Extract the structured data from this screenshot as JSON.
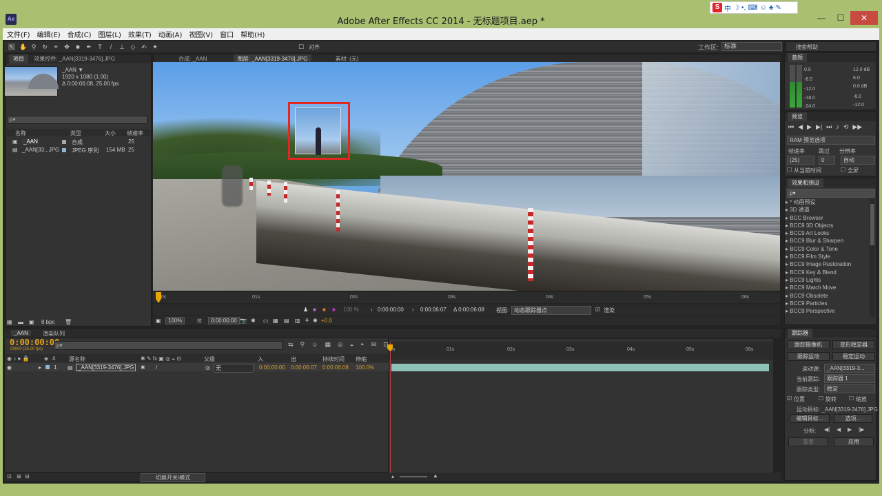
{
  "window": {
    "title": "Adobe After Effects CC 2014 - 无标题项目.aep *",
    "app_icon": "Ae",
    "ime_brand": "S",
    "ime_text": "中"
  },
  "menu": [
    "文件(F)",
    "编辑(E)",
    "合成(C)",
    "图层(L)",
    "效果(T)",
    "动画(A)",
    "视图(V)",
    "窗口",
    "帮助(H)"
  ],
  "toolbar": {
    "snap_label": "对齐",
    "workspace_label": "工作区:",
    "workspace_value": "标准",
    "help_search": "搜索帮助"
  },
  "project_panel": {
    "tabs": [
      "项目",
      "效果控件: _AAN[3319-3476].JPG"
    ],
    "item_name": "_AAN ▼",
    "item_size": "1920 x 1080 (1.00)",
    "item_duration": "Δ 0:00:06:08, 25.00 fps",
    "search_placeholder": "ρ▾",
    "columns": {
      "name": "名称",
      "type": "类型",
      "size": "大小",
      "rate": "帧速率"
    },
    "rows": [
      {
        "name": "_AAN",
        "type": "合成",
        "size": "",
        "rate": "25",
        "color": "#a8a8a8"
      },
      {
        "name": "_AAN[33...JPG",
        "type": "JPEG 序列",
        "size": "154 MB",
        "rate": "25",
        "color": "#8eb5d6"
      }
    ],
    "bpc": "8 bpc"
  },
  "viewer": {
    "tabs": [
      "合成: _AAN",
      "图层: _AAN[3319-3476].JPG",
      "素材: (无)"
    ],
    "ruler_ticks": [
      "00s",
      "01s",
      "02s",
      "03s",
      "04s",
      "05s",
      "06s"
    ],
    "controls": {
      "zoom": "100 %",
      "in": "0:00:00:00",
      "out": "0:00:06:07",
      "duration": "Δ 0:00:06:08",
      "view_label": "视图:",
      "view_value": "动态跟踪器点",
      "render_label": "渲染"
    },
    "bottom": {
      "zoom": "100%",
      "timecode": "0:00:00:00",
      "exposure": "+0.0"
    }
  },
  "audio_panel": {
    "title": "音频",
    "db_left": [
      "0.0",
      "-6.0",
      "-12.0",
      "-18.0",
      "-24.0"
    ],
    "db_right": [
      "12.0 dB",
      "6.0",
      "0.0 dB",
      "-6.0",
      "-12.0"
    ]
  },
  "preview_panel": {
    "title": "预览",
    "ram_options": "RAM 预览选项",
    "frame_rate_label": "帧速率",
    "skip_label": "跳过",
    "resolution_label": "分辨率",
    "frame_rate_value": "(25)",
    "skip_value": "0",
    "resolution_value": "自动",
    "from_current": "从当前时间",
    "fullscreen": "全屏"
  },
  "effects_panel": {
    "title": "效果和预设",
    "search_placeholder": "ρ▾",
    "items": [
      "* 动画预设",
      "3D 通道",
      "BCC Browser",
      "BCC9 3D Objects",
      "BCC9 Art Looks",
      "BCC9 Blur & Sharpen",
      "BCC9 Color & Tone",
      "BCC9 Film Style",
      "BCC9 Image Restoration",
      "BCC9 Key & Blend",
      "BCC9 Lights",
      "BCC9 Match Move",
      "BCC9 Obsolete",
      "BCC9 Particles",
      "BCC9 Perspective"
    ]
  },
  "tracker_panel": {
    "title": "跟踪器",
    "track_camera": "跟踪摄像机",
    "warp_stabilizer": "变形稳定器",
    "track_motion": "跟踪运动",
    "stabilize_motion": "稳定运动",
    "motion_source_label": "运动源:",
    "motion_source_value": "_AAN[3319-3...",
    "current_track_label": "当前跟踪:",
    "current_track_value": "跟踪器 1",
    "track_type_label": "跟踪类型:",
    "track_type_value": "稳定",
    "position": "位置",
    "rotation": "旋转",
    "scale": "缩放",
    "motion_target": "运动目标: _AAN[3319-3476].JPG",
    "edit_target": "编辑目标...",
    "options": "选项...",
    "analyze_label": "分析:",
    "reset": "重置",
    "apply": "应用"
  },
  "timeline": {
    "tabs": [
      "_AAN",
      "渲染队列"
    ],
    "timecode": "0:00:00:00",
    "fps": "00000 (25.00 fps)",
    "search_placeholder": "ρ▾",
    "ruler_ticks": [
      "0s",
      "01s",
      "02s",
      "03s",
      "04s",
      "05s",
      "06s"
    ],
    "columns": {
      "num": "#",
      "source_name": "源名称",
      "parent": "父级",
      "in": "入",
      "out": "出",
      "duration": "持续时间",
      "stretch": "伸缩"
    },
    "layer": {
      "num": "1",
      "name": "_AAN[3319-3476].JPG",
      "parent": "无",
      "in": "0:00:00:00",
      "out": "0:00:06:07",
      "duration": "0:00:06:08",
      "stretch": "100.0%"
    },
    "toggle_modes": "切换开关/模式"
  },
  "colors": {
    "accent": "#e3a418",
    "track_box": "#e3261f",
    "layer_bar": "#8ec3ba",
    "window_frame": "#a9c071"
  }
}
